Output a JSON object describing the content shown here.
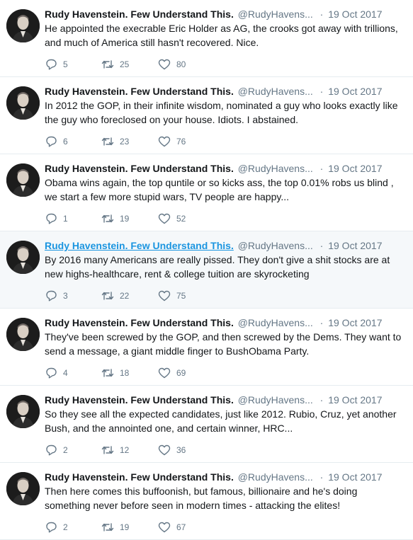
{
  "colors": {
    "name": "#14171a",
    "meta": "#657786",
    "link": "#1b95e0",
    "hover_bg": "#f5f8fa"
  },
  "icons": {
    "reply": "reply-icon",
    "retweet": "retweet-icon",
    "like": "heart-icon"
  },
  "tweets": [
    {
      "name": "Rudy Havenstein. Few Understand This.",
      "handle": "@RudyHavens...",
      "time": "19 Oct 2017",
      "text": "He appointed the execrable Eric Holder as AG, the crooks got away with trillions, and much of America still hasn't recovered. Nice.",
      "replies": "5",
      "retweets": "25",
      "likes": "80"
    },
    {
      "name": "Rudy Havenstein. Few Understand This.",
      "handle": "@RudyHavens...",
      "time": "19 Oct 2017",
      "text": "In 2012 the GOP, in their infinite wisdom, nominated a guy who looks exactly like the guy who foreclosed on your house. Idiots. I abstained.",
      "replies": "6",
      "retweets": "23",
      "likes": "76"
    },
    {
      "name": "Rudy Havenstein. Few Understand This.",
      "handle": "@RudyHavens...",
      "time": "19 Oct 2017",
      "text": "Obama wins again, the top quntile or so kicks ass, the top 0.01% robs us blind , we start a few more stupid wars, TV people are happy...",
      "replies": "1",
      "retweets": "19",
      "likes": "52"
    },
    {
      "name": "Rudy Havenstein. Few Understand This.",
      "handle": "@RudyHavens...",
      "time": "19 Oct 2017",
      "text": "By 2016 many Americans are really pissed. They don't give a shit stocks are at new highs-healthcare, rent & college tuition are skyrocketing",
      "replies": "3",
      "retweets": "22",
      "likes": "75"
    },
    {
      "name": "Rudy Havenstein. Few Understand This.",
      "handle": "@RudyHavens...",
      "time": "19 Oct 2017",
      "text": "They've been screwed by the GOP, and then screwed by the Dems. They want to send a message, a giant middle finger to BushObama Party.",
      "replies": "4",
      "retweets": "18",
      "likes": "69"
    },
    {
      "name": "Rudy Havenstein. Few Understand This.",
      "handle": "@RudyHavens...",
      "time": "19 Oct 2017",
      "text": "So they see all the expected candidates, just like 2012. Rubio, Cruz, yet another Bush, and the annointed one, and certain winner, HRC...",
      "replies": "2",
      "retweets": "12",
      "likes": "36"
    },
    {
      "name": "Rudy Havenstein. Few Understand This.",
      "handle": "@RudyHavens...",
      "time": "19 Oct 2017",
      "text": "Then here comes this buffoonish, but famous, billionaire and he's doing something never before seen in modern times - attacking the elites!",
      "replies": "2",
      "retweets": "19",
      "likes": "67"
    }
  ]
}
